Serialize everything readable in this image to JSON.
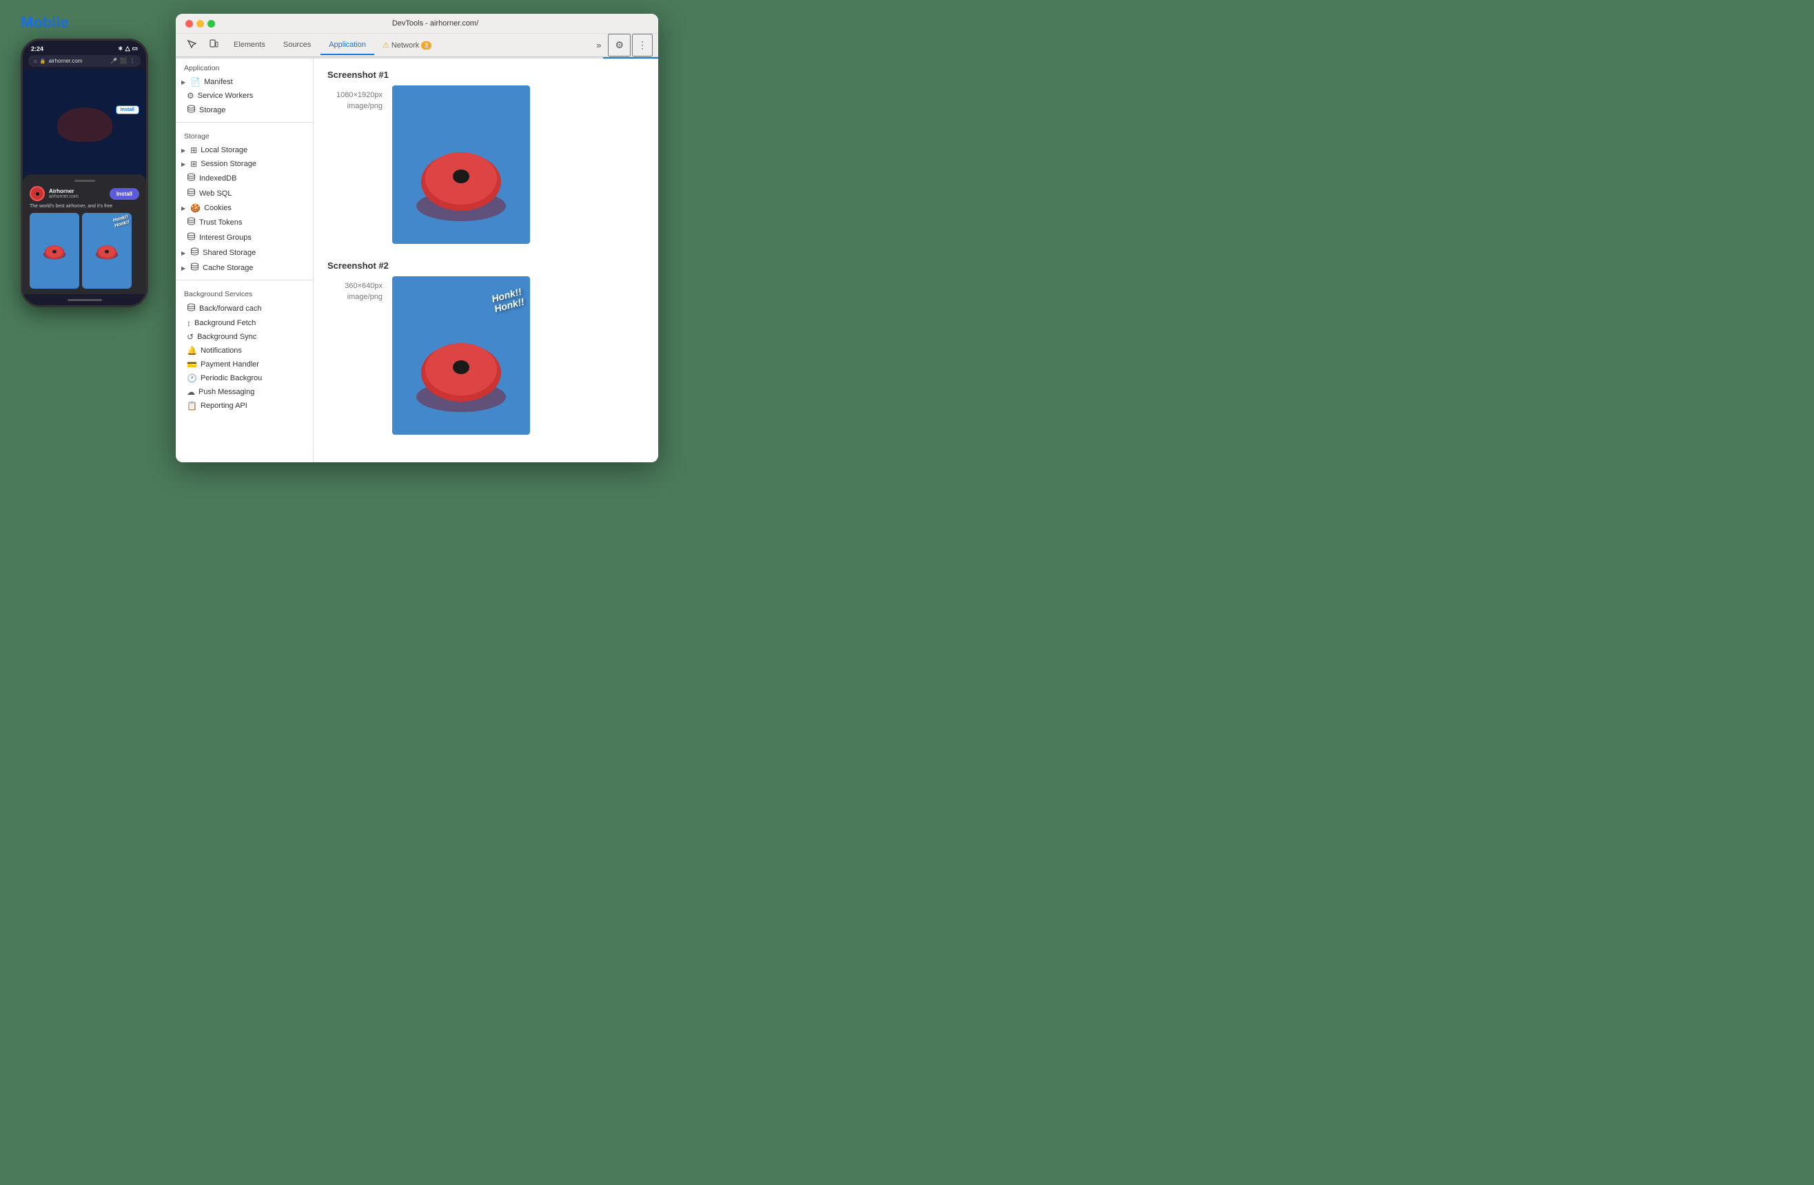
{
  "page": {
    "background_color": "#4a7a5a"
  },
  "mobile": {
    "title": "Mobile",
    "title_color": "#1a6fe8",
    "status_bar": {
      "time": "2:24"
    },
    "url": "airhorner.com",
    "install_button_top": "Install",
    "app_name": "Airhorner",
    "app_domain": "airhorner.com",
    "install_button_sheet": "Install",
    "description": "The world's best airhorner, and it's free"
  },
  "devtools": {
    "window_title": "DevTools - airhorner.com/",
    "tabs": [
      {
        "label": "Elements",
        "active": false
      },
      {
        "label": "Sources",
        "active": false
      },
      {
        "label": "Application",
        "active": true
      },
      {
        "label": "Network",
        "active": false,
        "warning": true,
        "warning_count": "2"
      }
    ],
    "sidebar": {
      "sections": [
        {
          "label": "Application",
          "items": [
            {
              "id": "manifest",
              "label": "Manifest",
              "icon": "📄",
              "has_arrow": true,
              "selected": false
            },
            {
              "id": "service-workers",
              "label": "Service Workers",
              "icon": "⚙️",
              "selected": false
            },
            {
              "id": "storage",
              "label": "Storage",
              "icon": "🗄️",
              "selected": false
            }
          ]
        },
        {
          "label": "Storage",
          "items": [
            {
              "id": "local-storage",
              "label": "Local Storage",
              "icon": "⊞",
              "has_arrow": true
            },
            {
              "id": "session-storage",
              "label": "Session Storage",
              "icon": "⊞",
              "has_arrow": true
            },
            {
              "id": "indexeddb",
              "label": "IndexedDB",
              "icon": "🗄️"
            },
            {
              "id": "web-sql",
              "label": "Web SQL",
              "icon": "🗄️"
            },
            {
              "id": "cookies",
              "label": "Cookies",
              "icon": "🍪",
              "has_arrow": true
            },
            {
              "id": "trust-tokens",
              "label": "Trust Tokens",
              "icon": "🗄️"
            },
            {
              "id": "interest-groups",
              "label": "Interest Groups",
              "icon": "🗄️"
            },
            {
              "id": "shared-storage",
              "label": "Shared Storage",
              "icon": "🗄️",
              "has_arrow": true
            },
            {
              "id": "cache-storage",
              "label": "Cache Storage",
              "icon": "🗄️",
              "has_arrow": true
            }
          ]
        },
        {
          "label": "Background Services",
          "items": [
            {
              "id": "back-forward-cache",
              "label": "Back/forward cach",
              "icon": "🗄️"
            },
            {
              "id": "background-fetch",
              "label": "Background Fetch",
              "icon": "↕"
            },
            {
              "id": "background-sync",
              "label": "Background Sync",
              "icon": "🔄"
            },
            {
              "id": "notifications",
              "label": "Notifications",
              "icon": "🔔"
            },
            {
              "id": "payment-handler",
              "label": "Payment Handler",
              "icon": "💳"
            },
            {
              "id": "periodic-background",
              "label": "Periodic Backgrou",
              "icon": "🕐"
            },
            {
              "id": "push-messaging",
              "label": "Push Messaging",
              "icon": "☁️"
            },
            {
              "id": "reporting-api",
              "label": "Reporting API",
              "icon": "📋"
            }
          ]
        }
      ]
    },
    "content": {
      "screenshots": [
        {
          "title": "Screenshot #1",
          "dimensions": "1080×1920px",
          "mime": "image/png",
          "has_honk": false
        },
        {
          "title": "Screenshot #2",
          "dimensions": "360×640px",
          "mime": "image/png",
          "has_honk": true
        }
      ]
    }
  }
}
